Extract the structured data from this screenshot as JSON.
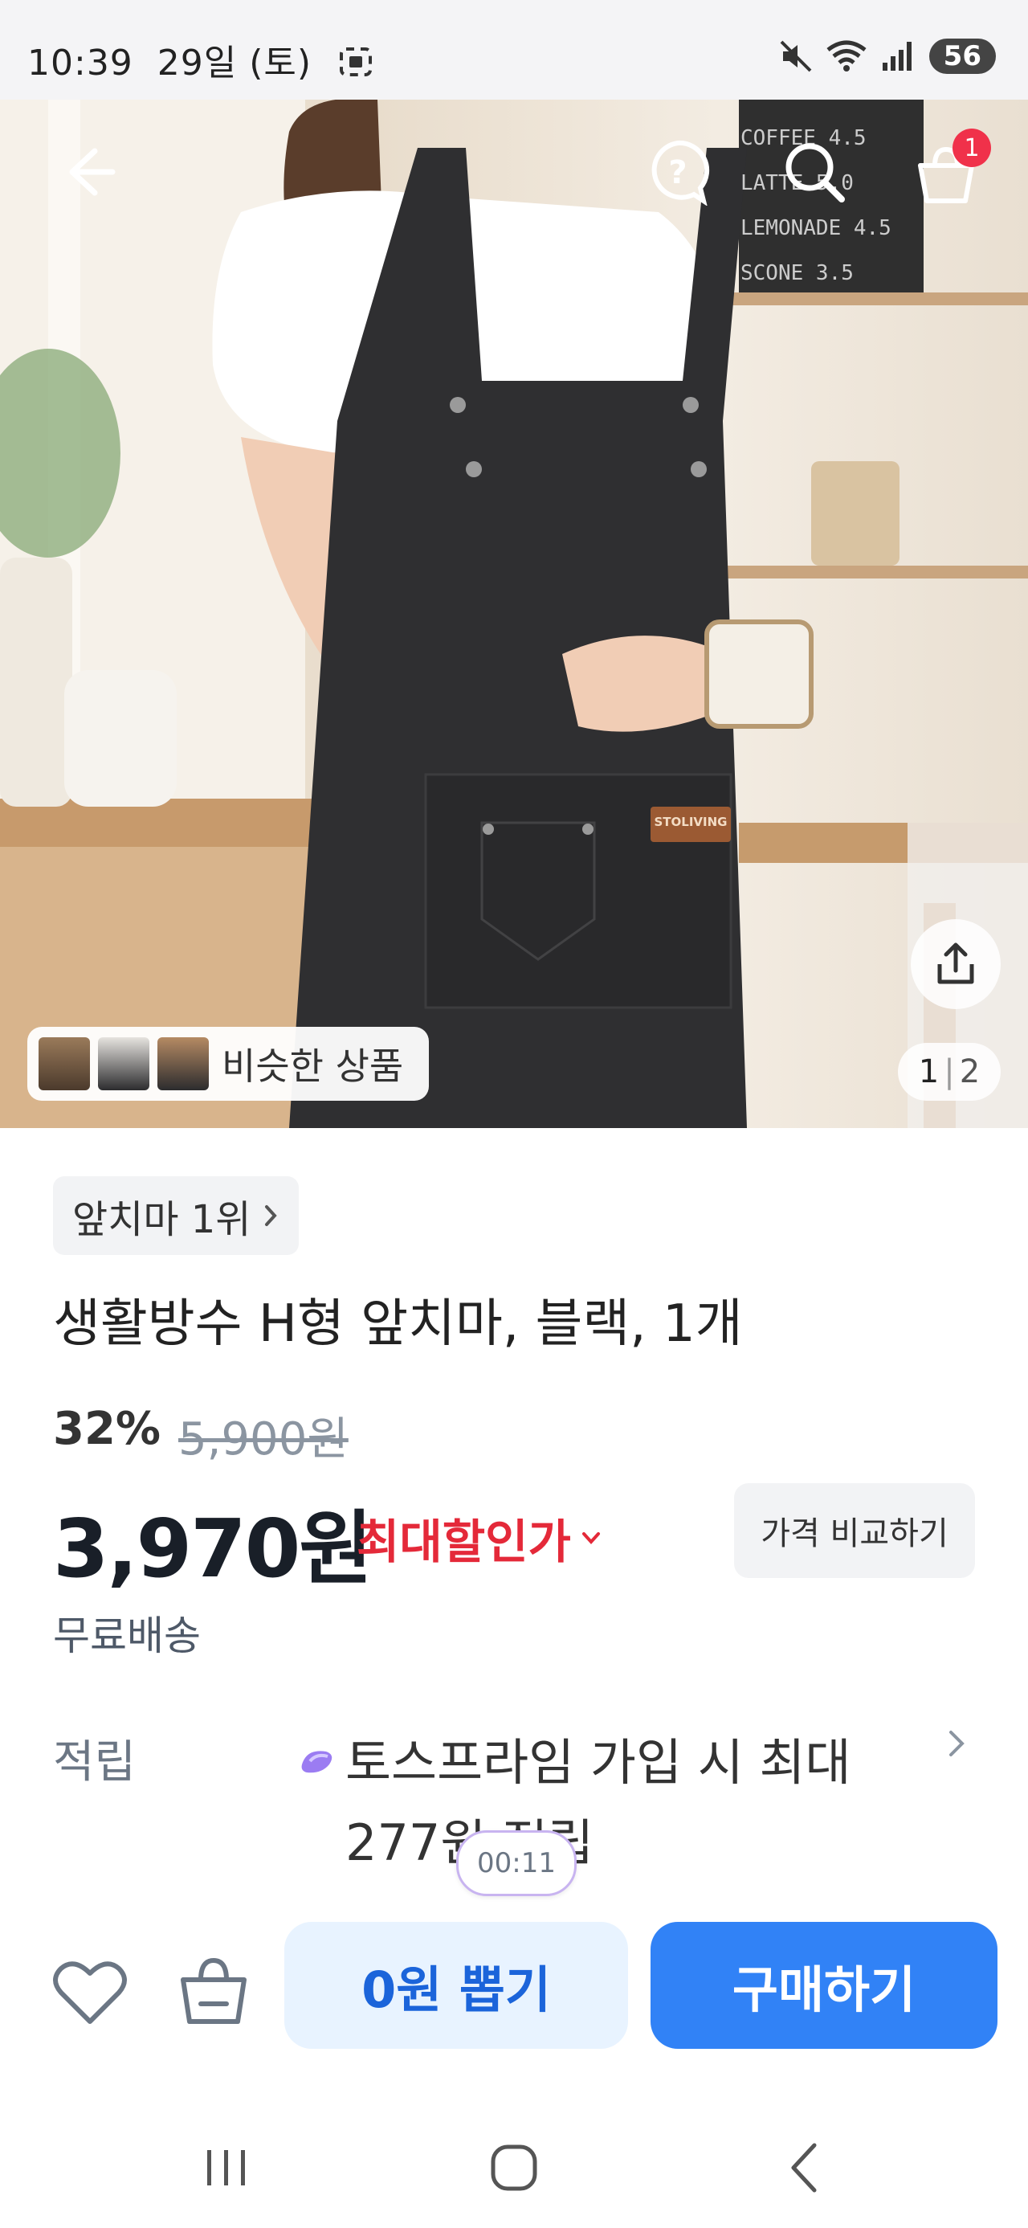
{
  "status_bar": {
    "time": "10:39",
    "date": "29일 (토)",
    "battery": "56"
  },
  "hero": {
    "cart_count": "1",
    "similar_label": "비슷한 상품",
    "pager_current": "1",
    "pager_total": "2",
    "brand_tag": "STOLIVING",
    "menu_board": [
      "COFFEE 4.5",
      "LATTE 5.0",
      "LEMONADE 4.5",
      "SCONE 3.5"
    ]
  },
  "product": {
    "rank_chip": "앞치마 1위",
    "title": "생활방수 H형 앞치마, 블랙, 1개",
    "discount": "32%",
    "original_price": "5,900원",
    "price": "3,970원",
    "price_tag": "최대할인가",
    "compare_button": "가격 비교하기",
    "shipping": "무료배송",
    "earn_label": "적립",
    "earn_text_line1": "토스프라임 가입 시 최대",
    "earn_text_line2": "277원 적립",
    "timer": "00:11"
  },
  "actions": {
    "zero_won_draw": "0원 뽑기",
    "buy": "구매하기"
  },
  "colors": {
    "accent": "#3182f6",
    "sale_red": "#e42939",
    "light_blue": "#e8f3ff"
  }
}
